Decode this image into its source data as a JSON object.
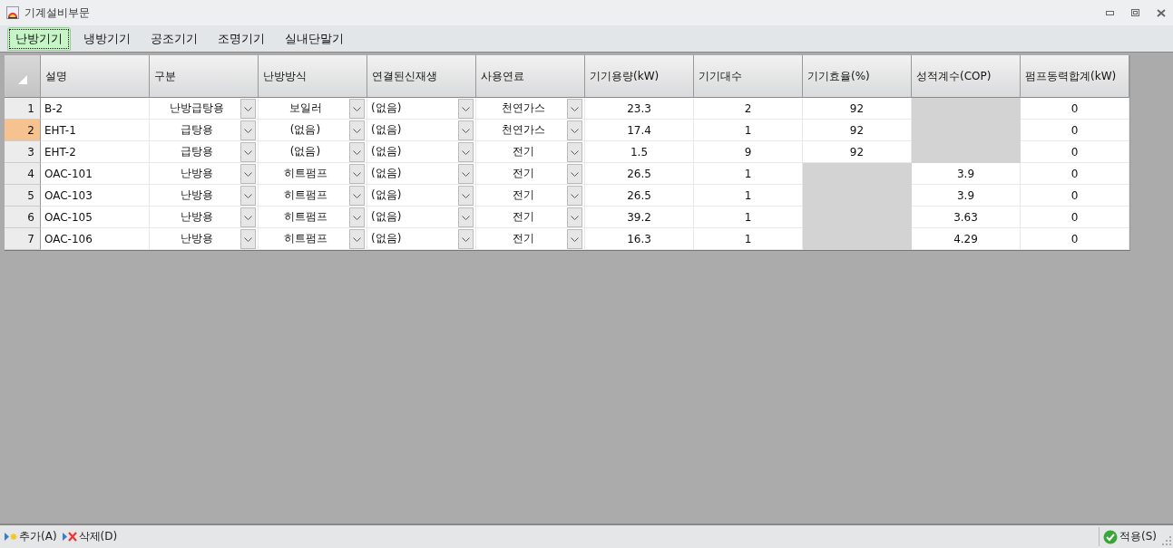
{
  "window": {
    "title": "기계설비부문"
  },
  "tabs": [
    {
      "label": "난방기기",
      "selected": true
    },
    {
      "label": "냉방기기",
      "selected": false
    },
    {
      "label": "공조기기",
      "selected": false
    },
    {
      "label": "조명기기",
      "selected": false
    },
    {
      "label": "실내단말기",
      "selected": false
    }
  ],
  "table": {
    "columns": [
      "설명",
      "구분",
      "난방방식",
      "연결된신재생",
      "사용연료",
      "기기용량(kW)",
      "기기대수",
      "기기효율(%)",
      "성적계수(COP)",
      "펌프동력합계(kW)"
    ],
    "rows": [
      {
        "number": "1",
        "selected": false,
        "cells": [
          {
            "kind": "text",
            "value": "B-2"
          },
          {
            "kind": "combo",
            "value": "난방급탕용"
          },
          {
            "kind": "combo",
            "value": "보일러"
          },
          {
            "kind": "select",
            "value": "(없음)"
          },
          {
            "kind": "combo",
            "value": "천연가스"
          },
          {
            "kind": "number",
            "value": "23.3"
          },
          {
            "kind": "number",
            "value": "2"
          },
          {
            "kind": "number",
            "value": "92"
          },
          {
            "kind": "disabled"
          },
          {
            "kind": "number",
            "value": "0"
          }
        ]
      },
      {
        "number": "2",
        "selected": true,
        "cells": [
          {
            "kind": "text",
            "value": "EHT-1"
          },
          {
            "kind": "combo",
            "value": "급탕용"
          },
          {
            "kind": "combo",
            "value": "(없음)"
          },
          {
            "kind": "select",
            "value": "(없음)"
          },
          {
            "kind": "combo",
            "value": "천연가스"
          },
          {
            "kind": "number",
            "value": "17.4"
          },
          {
            "kind": "number",
            "value": "1"
          },
          {
            "kind": "number",
            "value": "92"
          },
          {
            "kind": "disabled"
          },
          {
            "kind": "number",
            "value": "0"
          }
        ]
      },
      {
        "number": "3",
        "selected": false,
        "cells": [
          {
            "kind": "text",
            "value": "EHT-2"
          },
          {
            "kind": "combo",
            "value": "급탕용"
          },
          {
            "kind": "combo",
            "value": "(없음)"
          },
          {
            "kind": "select",
            "value": "(없음)"
          },
          {
            "kind": "combo",
            "value": "전기"
          },
          {
            "kind": "number",
            "value": "1.5"
          },
          {
            "kind": "number",
            "value": "9"
          },
          {
            "kind": "number",
            "value": "92"
          },
          {
            "kind": "disabled"
          },
          {
            "kind": "number",
            "value": "0"
          }
        ]
      },
      {
        "number": "4",
        "selected": false,
        "cells": [
          {
            "kind": "text",
            "value": "OAC-101"
          },
          {
            "kind": "combo",
            "value": "난방용"
          },
          {
            "kind": "combo",
            "value": "히트펌프"
          },
          {
            "kind": "select",
            "value": "(없음)"
          },
          {
            "kind": "combo",
            "value": "전기"
          },
          {
            "kind": "number",
            "value": "26.5"
          },
          {
            "kind": "number",
            "value": "1"
          },
          {
            "kind": "disabled"
          },
          {
            "kind": "number",
            "value": "3.9"
          },
          {
            "kind": "number",
            "value": "0"
          }
        ]
      },
      {
        "number": "5",
        "selected": false,
        "cells": [
          {
            "kind": "text",
            "value": "OAC-103"
          },
          {
            "kind": "combo",
            "value": "난방용"
          },
          {
            "kind": "combo",
            "value": "히트펌프"
          },
          {
            "kind": "select",
            "value": "(없음)"
          },
          {
            "kind": "combo",
            "value": "전기"
          },
          {
            "kind": "number",
            "value": "26.5"
          },
          {
            "kind": "number",
            "value": "1"
          },
          {
            "kind": "disabled"
          },
          {
            "kind": "number",
            "value": "3.9"
          },
          {
            "kind": "number",
            "value": "0"
          }
        ]
      },
      {
        "number": "6",
        "selected": false,
        "cells": [
          {
            "kind": "text",
            "value": "OAC-105"
          },
          {
            "kind": "combo",
            "value": "난방용"
          },
          {
            "kind": "combo",
            "value": "히트펌프"
          },
          {
            "kind": "select",
            "value": "(없음)"
          },
          {
            "kind": "combo",
            "value": "전기"
          },
          {
            "kind": "number",
            "value": "39.2"
          },
          {
            "kind": "number",
            "value": "1"
          },
          {
            "kind": "disabled"
          },
          {
            "kind": "number",
            "value": "3.63"
          },
          {
            "kind": "number",
            "value": "0"
          }
        ]
      },
      {
        "number": "7",
        "selected": false,
        "cells": [
          {
            "kind": "text",
            "value": "OAC-106"
          },
          {
            "kind": "combo",
            "value": "난방용"
          },
          {
            "kind": "combo",
            "value": "히트펌프"
          },
          {
            "kind": "select",
            "value": "(없음)"
          },
          {
            "kind": "combo",
            "value": "전기"
          },
          {
            "kind": "number",
            "value": "16.3"
          },
          {
            "kind": "number",
            "value": "1"
          },
          {
            "kind": "disabled"
          },
          {
            "kind": "number",
            "value": "4.29"
          },
          {
            "kind": "number",
            "value": "0"
          }
        ]
      }
    ]
  },
  "toolbar": {
    "left": [
      {
        "kind": "add",
        "label": "추가(A)"
      },
      {
        "kind": "delete",
        "label": "삭제(D)"
      }
    ],
    "right": [
      {
        "kind": "apply",
        "label": "적용(S)"
      }
    ]
  }
}
